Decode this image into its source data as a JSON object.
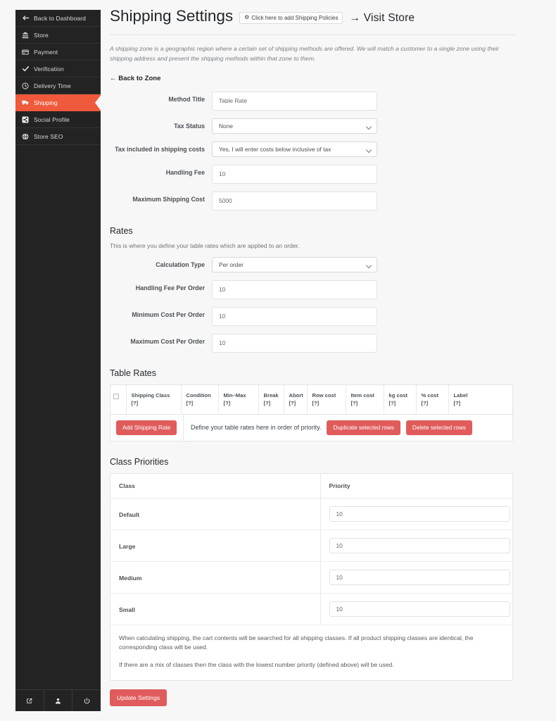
{
  "colors": {
    "accent_orange": "#ee5a3b",
    "button_red": "#e05c5c",
    "sidebar_bg": "#232323",
    "page_bg": "#f7f7f7"
  },
  "sidebar": {
    "items": [
      {
        "label": "Back to Dashboard",
        "icon": "arrow-left-icon",
        "active": false
      },
      {
        "label": "Store",
        "icon": "bank-icon",
        "active": false
      },
      {
        "label": "Payment",
        "icon": "credit-card-icon",
        "active": false
      },
      {
        "label": "Verification",
        "icon": "check-icon",
        "active": false
      },
      {
        "label": "Delivery Time",
        "icon": "clock-icon",
        "active": false
      },
      {
        "label": "Shipping",
        "icon": "truck-icon",
        "active": true
      },
      {
        "label": "Social Profile",
        "icon": "share-icon",
        "active": false
      },
      {
        "label": "Store SEO",
        "icon": "globe-icon",
        "active": false
      }
    ],
    "bottom_icons": [
      {
        "name": "external-link-icon"
      },
      {
        "name": "user-icon"
      },
      {
        "name": "power-icon"
      }
    ]
  },
  "header": {
    "title": "Shipping Settings",
    "policy_button": "Click here to add Shipping Policies",
    "policy_button_icon": "gear-icon",
    "visit_store": "→ Visit Store"
  },
  "intro": "A shipping zone is a geographic region where a certain set of shipping methods are offered. We will match a customer to a single zone using their shipping address and present the shipping methods within that zone to them.",
  "back_to_zone": "← Back to Zone",
  "method_form": {
    "fields": [
      {
        "label": "Method Title",
        "type": "text",
        "value": "Table Rate"
      },
      {
        "label": "Tax Status",
        "type": "select",
        "value": "None"
      },
      {
        "label": "Tax included in shipping costs",
        "type": "select",
        "value": "Yes, I will enter costs below inclusive of tax"
      },
      {
        "label": "Handling Fee",
        "type": "text",
        "value": "10"
      },
      {
        "label": "Maximum Shipping Cost",
        "type": "text",
        "value": "5000"
      }
    ]
  },
  "rates": {
    "title": "Rates",
    "description": "This is where you define your table rates which are applied to an order.",
    "fields": [
      {
        "label": "Calculation Type",
        "type": "select",
        "value": "Per order"
      },
      {
        "label": "Handling Fee Per Order",
        "type": "text",
        "value": "10"
      },
      {
        "label": "Minimum Cost Per Order",
        "type": "text",
        "value": "10"
      },
      {
        "label": "Maximum Cost Per Order",
        "type": "text",
        "value": "10"
      }
    ]
  },
  "table_rates": {
    "title": "Table Rates",
    "help_marker": "[?]",
    "columns": [
      "Shipping Class",
      "Condition",
      "Min–Max",
      "Break",
      "Abort",
      "Row cost",
      "Item cost",
      "kg cost",
      "% cost",
      "Label"
    ],
    "add_button": "Add Shipping Rate",
    "hint": "Define your table rates here in order of priority.",
    "duplicate_button": "Duplicate selected rows",
    "delete_button": "Delete selected rows"
  },
  "class_priorities": {
    "title": "Class Priorities",
    "headers": [
      "Class",
      "Priority"
    ],
    "rows": [
      {
        "class": "Default",
        "priority": "10"
      },
      {
        "class": "Large",
        "priority": "10"
      },
      {
        "class": "Medium",
        "priority": "10"
      },
      {
        "class": "Small",
        "priority": "10"
      }
    ],
    "note_1": "When calculating shipping, the cart contents will be searched for all shipping classes. If all product shipping classes are identical, the corresponding class will be used.",
    "note_2": "If there are a mix of classes then the class with the lowest number priority (defined above) will be used."
  },
  "update_button": "Update Settings"
}
